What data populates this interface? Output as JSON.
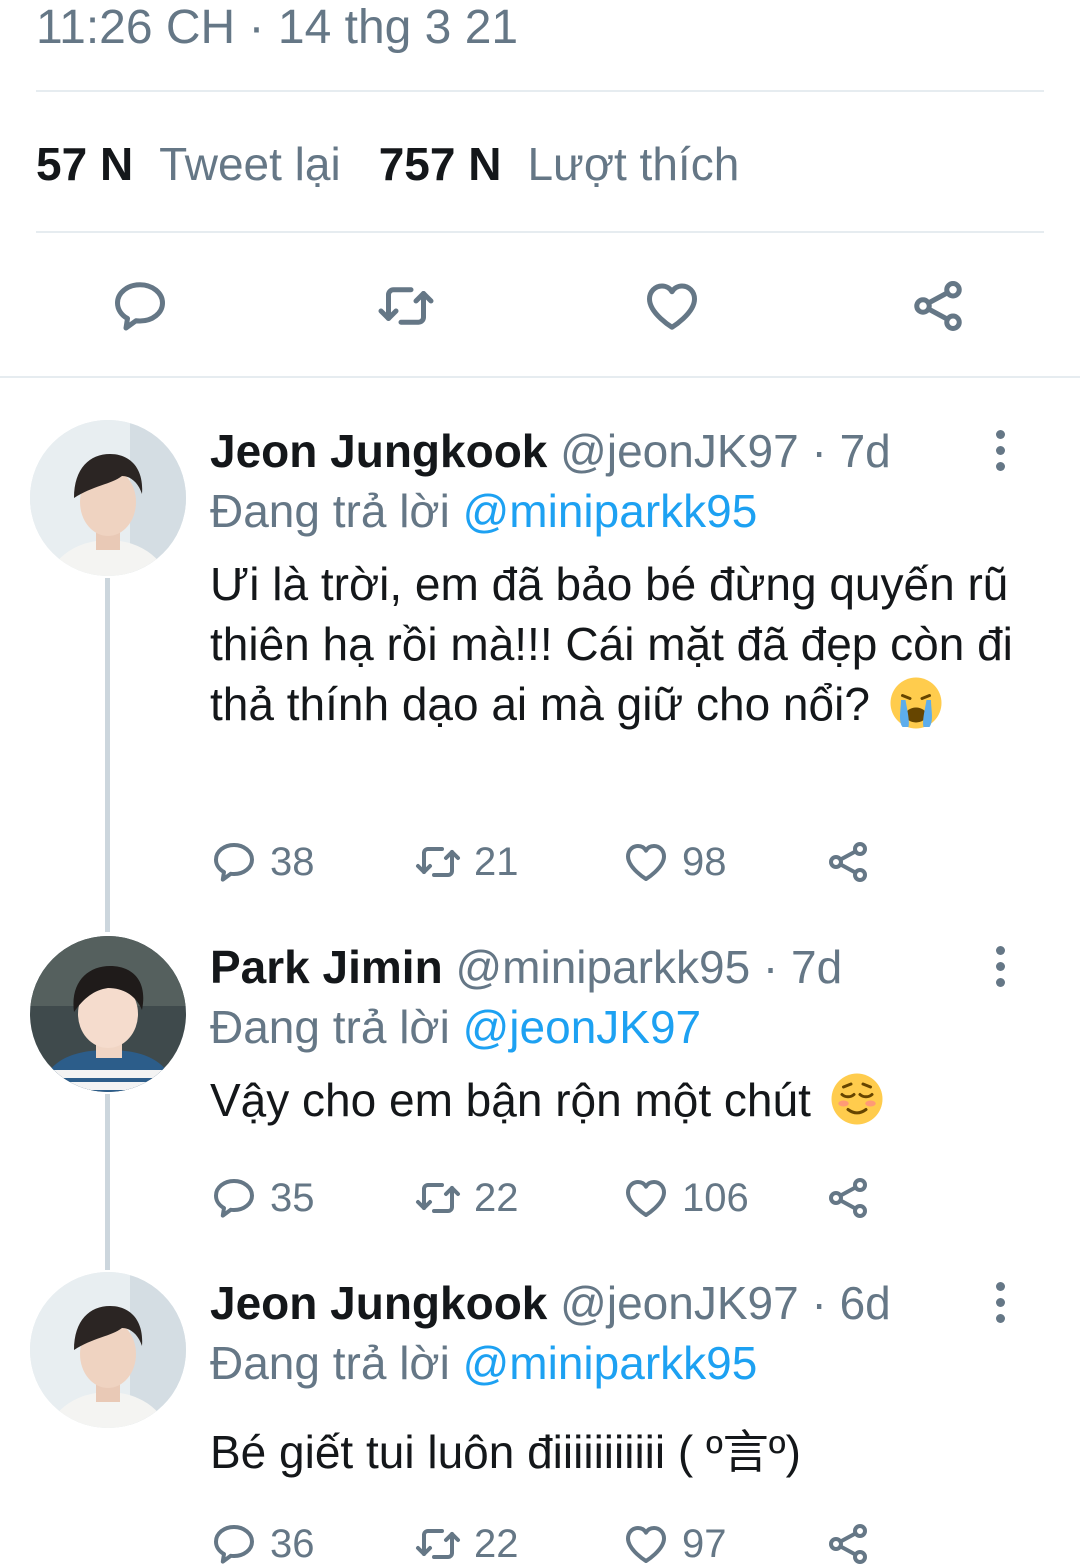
{
  "tweet": {
    "timestamp": "11:26 CH · 14 thg 3 21",
    "retweets_count": "57 N",
    "retweets_label": "Tweet lại",
    "likes_count": "757 N",
    "likes_label": "Lượt thích"
  },
  "action_bar": {
    "icons": [
      "reply-icon",
      "retweet-icon",
      "like-icon",
      "share-icon"
    ]
  },
  "replies": [
    {
      "name": "Jeon Jungkook",
      "handle": "@jeonJK97",
      "dot": " · ",
      "time": "7d",
      "replying_prefix": "Đang trả lời ",
      "replying_to": "@miniparkk95",
      "text": "Ưi là trời, em đã bảo bé đừng quyến rũ thiên hạ rồi mà!!! Cái mặt đã đẹp còn đi thả thính dạo ai mà giữ cho nổi?",
      "emoji": "loudly-crying-face",
      "replies": "38",
      "retweets": "21",
      "likes": "98"
    },
    {
      "name": "Park Jimin",
      "handle": "@miniparkk95",
      "dot": " · ",
      "time": "7d",
      "replying_prefix": "Đang trả lời ",
      "replying_to": "@jeonJK97",
      "text": "Vậy cho em bận rộn một chút",
      "emoji": "relieved-face",
      "replies": "35",
      "retweets": "22",
      "likes": "106"
    },
    {
      "name": "Jeon Jungkook",
      "handle": "@jeonJK97",
      "dot": " · ",
      "time": "6d",
      "replying_prefix": "Đang trả lời ",
      "replying_to": "@miniparkk95",
      "text": "Bé giết tui luôn điiiiiiiiiii ( º言º)",
      "emoji": "",
      "replies": "36",
      "retweets": "22",
      "likes": "97"
    }
  ],
  "colors": {
    "text": "#14171a",
    "secondary": "#657786",
    "link": "#1da1f2",
    "divider": "#e6ecf0",
    "thread_line": "#ccd6dd"
  }
}
